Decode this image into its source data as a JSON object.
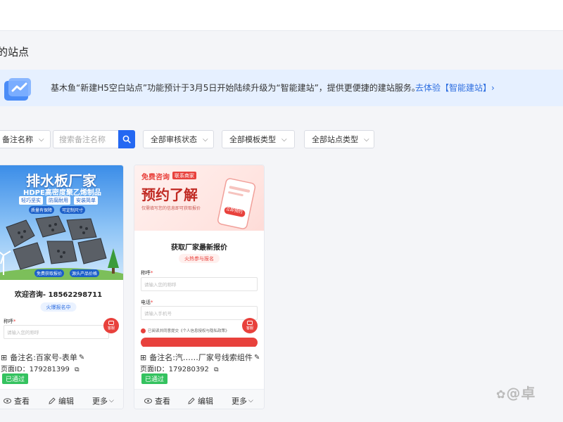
{
  "page": {
    "title": "的站点"
  },
  "banner": {
    "text": "基木鱼“新建H5空白站点”功能预计于3月5日开始陆续升级为“智能建站”，提供更便捷的建站服务。",
    "link": "去体验【智能建站】›"
  },
  "filters": {
    "name_select": "备注名称",
    "search_placeholder": "搜索备注名称",
    "audit_status": "全部审核状态",
    "template_type": "全部模板类型",
    "site_type": "全部站点类型"
  },
  "cards": [
    {
      "hero": {
        "headline": "排水板厂家",
        "subline": "HDPE高密度聚乙烯制品",
        "tags": [
          "轻巧坚实",
          "防腐耐用",
          "安装简单"
        ],
        "tags2": [
          "质量有保障",
          "可定制尺寸"
        ],
        "bottom_tags": [
          "免费获取报价",
          "源头产品价格"
        ]
      },
      "form": {
        "title": "欢迎咨询- 18562298711",
        "pill": "火爆报名中",
        "label": "称呼",
        "placeholder": "请输入您的称呼",
        "consult": "客服"
      },
      "name": "备注名:百家号-表单",
      "page_id": "页面ID：179281399",
      "status": "已通过",
      "actions": {
        "view": "查看",
        "edit": "编辑",
        "more": "更多"
      }
    },
    {
      "hero": {
        "chip1": "免费咨询",
        "chip2": "联系商家",
        "headline": "预约了解",
        "caption": "仅需填写您的信息即可获取报价",
        "phone_btn": "立即预约"
      },
      "form": {
        "title": "获取厂家最新报价",
        "pill": "火热参与报名",
        "label1": "称呼",
        "placeholder1": "请输入您的称呼",
        "label2": "电话",
        "placeholder2": "请输入手机号",
        "consent": "已阅读并同意提交《个人信息授权与隐私政策》",
        "consult": "客服"
      },
      "name": "备注名:汽……厂家号线索组件",
      "page_id": "页面ID：179280392",
      "status": "已通过",
      "actions": {
        "view": "查看",
        "edit": "编辑",
        "more": "更多"
      }
    }
  ],
  "watermark": "@卓",
  "colors": {
    "accent": "#2468f2",
    "approved": "#34c25f",
    "banner_bg": "#e6f0ff"
  }
}
